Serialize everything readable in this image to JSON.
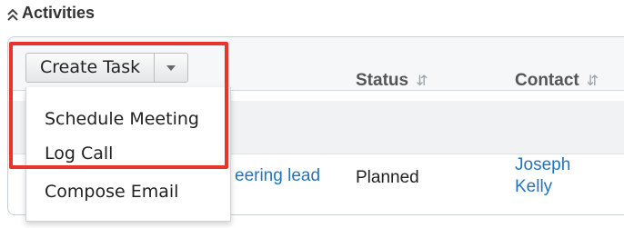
{
  "section": {
    "title": "Activities",
    "icon": "double-chevron-up-icon"
  },
  "toolbar": {
    "create_task_label": "Create Task",
    "caret_icon": "caret-down-icon"
  },
  "dropdown": {
    "items": [
      "Schedule Meeting",
      "Log Call",
      "Compose Email"
    ]
  },
  "table": {
    "columns": [
      "Status",
      "Contact"
    ],
    "row": {
      "subject": "eering lead",
      "status": "Planned",
      "contact": "Joseph\nKelly"
    }
  },
  "colors": {
    "highlight": "#e8342b",
    "link": "#2475bd"
  }
}
